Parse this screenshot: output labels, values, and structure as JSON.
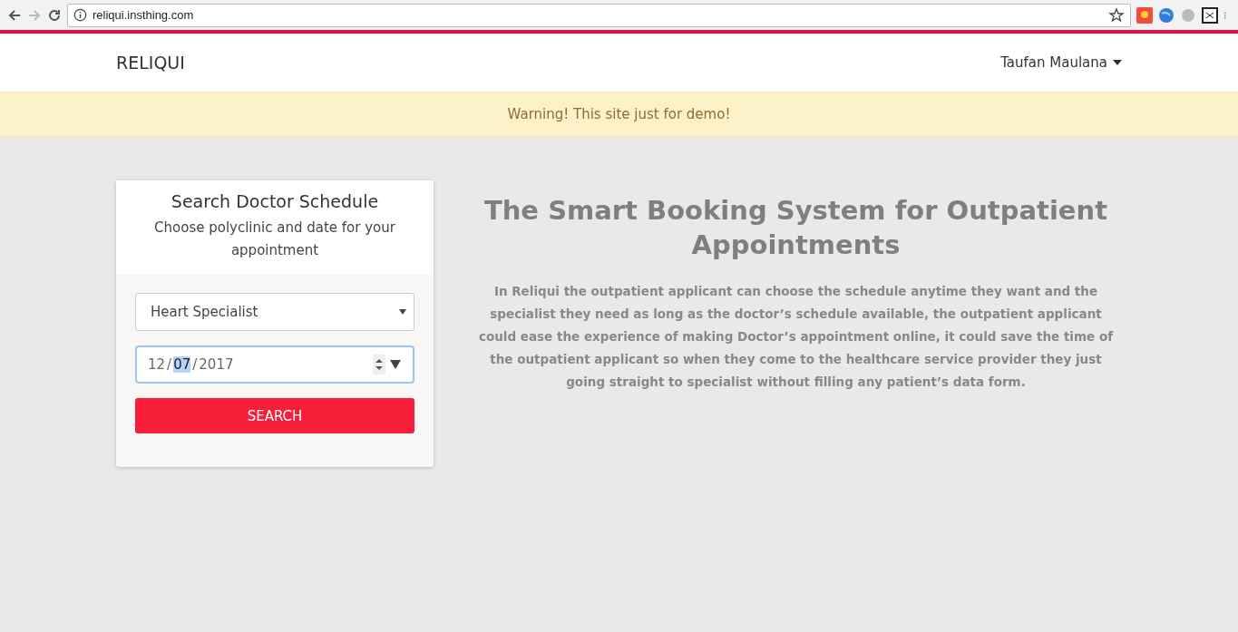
{
  "browser": {
    "url": "reliqui.insthing.com"
  },
  "navbar": {
    "brand": "RELIQUI",
    "user": "Taufan Maulana"
  },
  "alert": {
    "text": "Warning! This site just for demo!"
  },
  "search_card": {
    "title": "Search Doctor Schedule",
    "subtitle": "Choose polyclinic and date for your appointment",
    "polyclinic": "Heart Specialist",
    "date": {
      "separator": "/",
      "parts": [
        {
          "text": "12",
          "selected": false
        },
        {
          "text": "07",
          "selected": true
        },
        {
          "text": "2017",
          "selected": false
        }
      ]
    },
    "button": "SEARCH"
  },
  "hero": {
    "title": "The Smart Booking System for Outpatient Appointments",
    "text": "In Reliqui the outpatient applicant can choose the schedule anytime they want and the specialist they need as long as the doctor’s schedule available, the outpatient applicant could ease the experience of making Doctor’s appointment online, it could save the time of the outpatient applicant so when they come to the healthcare service provider they just going straight to specialist without filling any patient’s data form."
  }
}
